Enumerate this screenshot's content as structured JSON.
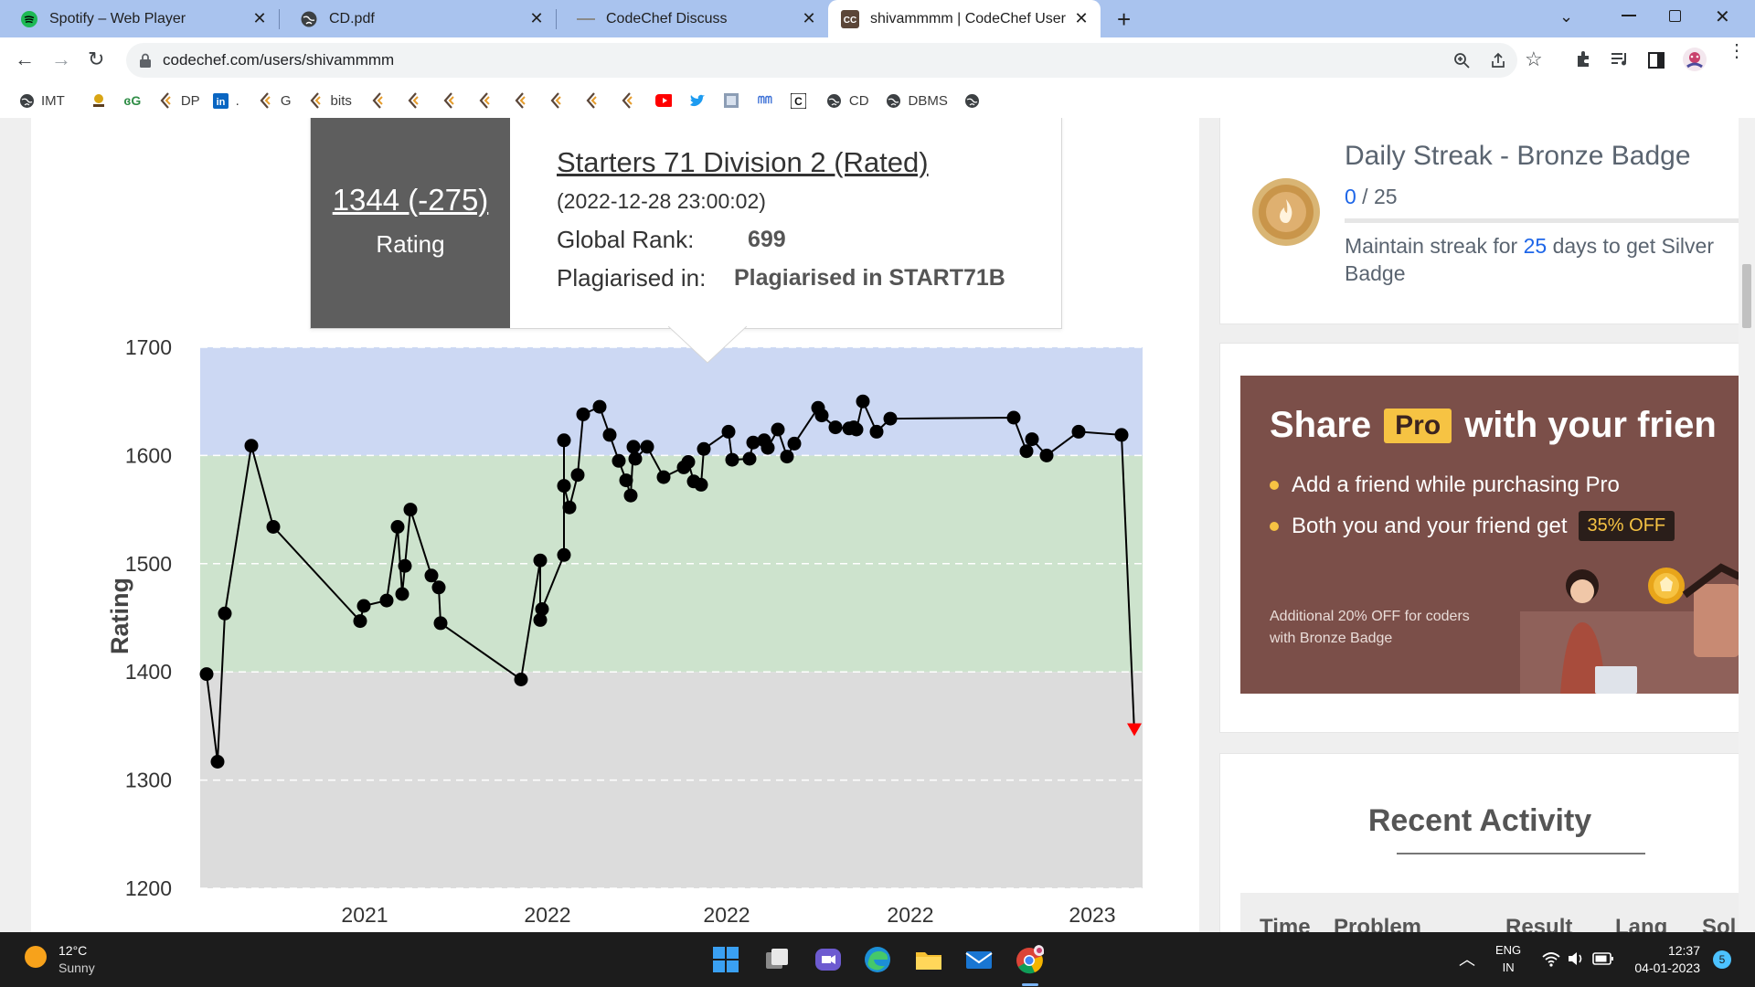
{
  "browser": {
    "tabs": [
      {
        "title": "Spotify – Web Player",
        "icon": "spotify-icon",
        "active": false
      },
      {
        "title": "CD.pdf",
        "icon": "globe-icon",
        "active": false
      },
      {
        "title": "CodeChef Discuss",
        "icon": "codechef-discuss-icon",
        "active": false
      },
      {
        "title": "shivammmm | CodeChef User Pr",
        "icon": "codechef-icon",
        "active": true
      }
    ],
    "url": "codechef.com/users/shivammmm",
    "bookmarks": [
      {
        "label": "IMT",
        "icon": "globe-icon"
      },
      {
        "label": "",
        "icon": "bookmark-icon"
      },
      {
        "label": "",
        "icon": "gfg-icon"
      },
      {
        "label": "DP",
        "icon": "codechef-icon"
      },
      {
        "label": ".",
        "icon": "linkedin-icon"
      },
      {
        "label": "G",
        "icon": "codechef-icon"
      },
      {
        "label": "bits",
        "icon": "codechef-icon"
      },
      {
        "label": "",
        "icon": "codechef-icon"
      },
      {
        "label": "",
        "icon": "codechef-icon"
      },
      {
        "label": "",
        "icon": "codechef-icon"
      },
      {
        "label": "",
        "icon": "codechef-icon"
      },
      {
        "label": "",
        "icon": "codechef-icon"
      },
      {
        "label": "",
        "icon": "codechef-icon"
      },
      {
        "label": "",
        "icon": "codechef-icon"
      },
      {
        "label": "",
        "icon": "codechef-icon"
      },
      {
        "label": "",
        "icon": "youtube-icon"
      },
      {
        "label": "",
        "icon": "twitter-icon"
      },
      {
        "label": "",
        "icon": "bookmark-icon"
      },
      {
        "label": "",
        "icon": "bookmark-icon"
      },
      {
        "label": "C",
        "icon": "c-icon"
      },
      {
        "label": "CD",
        "icon": "globe-icon"
      },
      {
        "label": "DBMS",
        "icon": "globe-icon"
      },
      {
        "label": "",
        "icon": "globe-icon"
      }
    ]
  },
  "tooltip": {
    "rating_change": "1344 (-275)",
    "rating_label": "Rating",
    "contest": "Starters 71 Division 2 (Rated)",
    "datetime": "(2022-12-28 23:00:02)",
    "rank_label": "Global Rank:",
    "rank_value": "699",
    "plag_label": "Plagiarised in:",
    "plag_value": "Plagiarised in START71B"
  },
  "chart_data": {
    "type": "line",
    "ylabel": "Rating",
    "ylim": [
      1200,
      1700
    ],
    "yticks": [
      1700,
      1600,
      1500,
      1400,
      1300,
      1200
    ],
    "xticks": [
      "2021",
      "2022",
      "2022",
      "2022",
      "2023"
    ],
    "bands": [
      {
        "from": 1200,
        "to": 1400,
        "color": "#dcdcdc"
      },
      {
        "from": 1400,
        "to": 1600,
        "color": "#cde3cd"
      },
      {
        "from": 1600,
        "to": 1700,
        "color": "#ccd8f3"
      }
    ],
    "series": [
      {
        "values": [
          1398,
          1317,
          1454,
          1609,
          1534,
          1447,
          1461,
          1466,
          1534,
          1472,
          1498,
          1550,
          1489,
          1478,
          1445,
          1393,
          1503,
          1448,
          1458,
          1508,
          1614,
          1572,
          1552,
          1582,
          1638,
          1645,
          1619,
          1595,
          1577,
          1563,
          1608,
          1597,
          1608,
          1580,
          1589,
          1594,
          1576,
          1573,
          1606,
          1622,
          1596,
          1597,
          1612,
          1614,
          1607,
          1624,
          1599,
          1611,
          1644,
          1637,
          1626,
          1625,
          1626,
          1624,
          1650,
          1622,
          1634,
          1635,
          1604,
          1615,
          1600,
          1622,
          1619,
          1344
        ],
        "last_point_color": "#ff0000"
      }
    ]
  },
  "streak": {
    "title": "Daily Streak - Bronze Badge",
    "current": "0",
    "total": " / 25",
    "desc_before": "Maintain streak for ",
    "desc_days": "25",
    "desc_after": " days to get Silver Badge"
  },
  "promo": {
    "share": "Share",
    "pro": "Pro",
    "with": "with your frien",
    "bullet1": "Add a friend while purchasing Pro",
    "bullet2": "Both you and your friend get",
    "off": "35% OFF",
    "note_line1": "Additional 20% OFF for coders",
    "note_line2": "with Bronze Badge"
  },
  "activity": {
    "title": "Recent Activity",
    "columns": [
      "Time",
      "Problem",
      "Result",
      "Lang",
      "Sol"
    ]
  },
  "taskbar": {
    "temp": "12°C",
    "weather": "Sunny",
    "lang1": "ENG",
    "lang2": "IN",
    "time": "12:37",
    "date": "04-01-2023",
    "notif": "5"
  },
  "colors": {
    "accent_blue": "#1e66e8",
    "tooltip_dark": "#5e5e5e",
    "promo_bg": "#7b4f49",
    "off_bg": "#2a1e1a",
    "pro_bg": "#f6c343"
  }
}
